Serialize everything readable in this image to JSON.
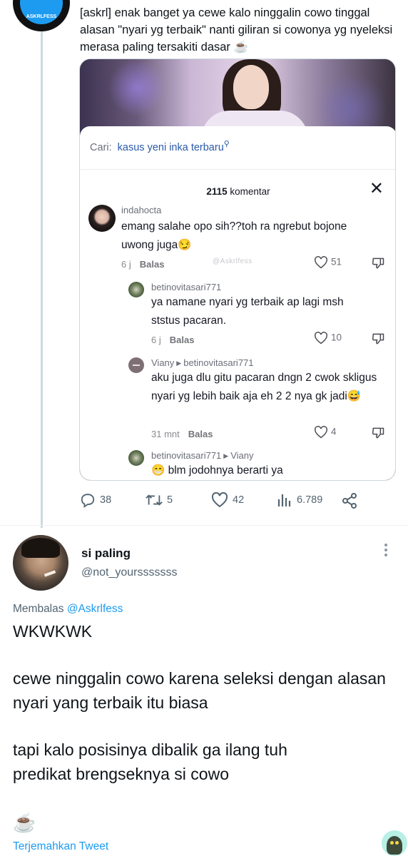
{
  "quoted_tweet": {
    "avatar_brand": "ASKRLFESS",
    "text": "[askrl] enak banget ya cewe kalo ninggalin cowo tinggal alasan \"nyari yg terbaik\" nanti giliran si cowonya yg nyeleksi merasa paling tersakiti dasar ☕",
    "tiktok": {
      "search_label": "Cari:",
      "search_query": "kasus yeni inka terbaru",
      "comment_count": "2115",
      "comment_word": "komentar",
      "watermark": "@Askrlfess",
      "reply_label": "Balas",
      "comments": [
        {
          "user": "indahocta",
          "text": "emang salahe opo sih??toh ra ngrebut bojone uwong juga😏",
          "time": "6 j",
          "likes": "51"
        },
        {
          "user": "betinovitasari771",
          "text": "ya namane nyari yg terbaik ap lagi msh ststus pacaran.",
          "time": "6 j",
          "likes": "10"
        },
        {
          "user": "Viany",
          "reply_to": "betinovitasari771",
          "text": "aku juga dlu gitu pacaran dngn 2 cwok skligus nyari yg lebih baik aja eh 2 2 nya gk jadi😅",
          "time": "31 mnt",
          "likes": "4"
        },
        {
          "user": "betinovitasari771",
          "reply_to": "Viany",
          "text": "😁 blm jodohnya berarti ya"
        }
      ]
    },
    "actions": {
      "replies": "38",
      "retweets": "5",
      "likes": "42",
      "views": "6.789"
    }
  },
  "reply_tweet": {
    "name": "si paling",
    "handle": "@not_yoursssssss",
    "replying_prefix": "Membalas",
    "replying_to": "@Askrlfess",
    "paragraphs": [
      "WKWKWK",
      "cewe ninggalin cowo karena seleksi dengan alasan nyari yang terbaik itu biasa",
      "tapi kalo posisinya dibalik ga ilang tuh predikat brengseknya si cowo",
      "☕"
    ],
    "translate_label": "Terjemahkan Tweet"
  },
  "colors": {
    "twitter_blue": "#1d9bf0",
    "secondary_text": "#536471",
    "tiktok_link": "#2b5aa8"
  },
  "icons": [
    "reply-icon",
    "retweet-icon",
    "like-icon",
    "views-icon",
    "share-icon",
    "close-icon",
    "heart-icon",
    "dislike-icon",
    "more-icon",
    "search-icon"
  ]
}
